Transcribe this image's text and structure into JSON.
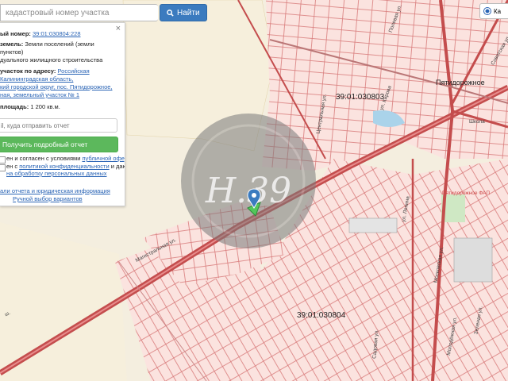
{
  "search": {
    "placeholder": "кадастровый номер участка",
    "button_label": "Найти"
  },
  "info_panel": {
    "line1_label": "ый номер:",
    "cadastral_link": "39:01:030804:228",
    "line2_label": "земель:",
    "line2_value": "Земли поселений (земли",
    "line3": "пунктов)",
    "line4": "дуального жилищного строительства",
    "address_label": "участок по адресу:",
    "address_l1": "Российская",
    "address_l2": "Калининградская область,",
    "address_l3": "кий городской округ, пос. Пятидорожное,",
    "address_l4": "ная, земельный участок № 1",
    "area_label": "площадь:",
    "area_value": "1 200 кв.м.",
    "email_placeholder": "il, куда отправить отчет",
    "report_button": "Получить подробный отчет",
    "consent_l1_pre": "ен и согласен с условиями ",
    "consent_l1_link": "публичной оферты",
    "consent_l2_pre": "ен с ",
    "consent_l2_link": "политикой конфиденциальности",
    "consent_l2_post": " и даю",
    "consent_l3_link": "на обработку персональных данных",
    "details_link": "али отчета и юридическая информация",
    "manual_link": "Ручной выбор вариантов",
    "close_glyph": "×"
  },
  "layer_toggle": {
    "label": "Ка"
  },
  "map": {
    "cadastral_block_1": "39:01:030803",
    "cadastral_block_2": "39:01:030804",
    "village": "Пятидорожное",
    "watermark": "Н.39",
    "streets": {
      "main_road": "Магистральная ул.",
      "road_left": "ш.",
      "school": "Школа",
      "fap": "Пятидорожное ФАП",
      "kirov": "ул. Кирова",
      "lenina": "ул. Ленина",
      "moskovskaya": "Московская ул.",
      "sovetskaya": "Советская ул.",
      "sadovaya": "Садовая ул.",
      "polevaya": "Полевая ул.",
      "tsentralnaya": "Центральная ул.",
      "molodezhnaya": "Молодёжная ул.",
      "zelenaya": "Зеленая ул."
    }
  },
  "colors": {
    "background": "#f4eedf",
    "parcel_fill": "#fbe3df",
    "parcel_stroke": "#d87b7b",
    "road": "#c44d4d",
    "accent_blue": "#3b7bbf",
    "green": "#5cb85c"
  }
}
